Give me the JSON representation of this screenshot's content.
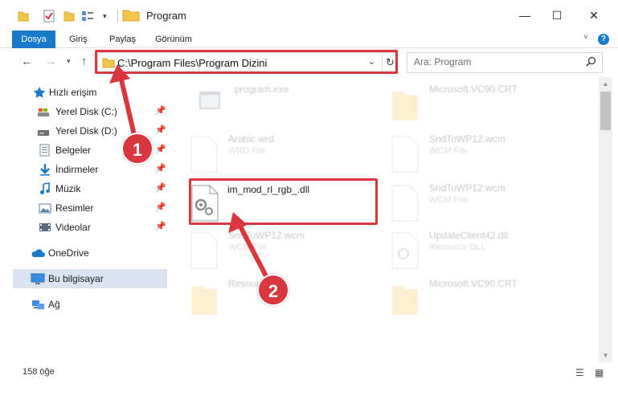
{
  "window": {
    "title": "Program",
    "minimize_glyph": "—",
    "maximize_glyph": "☐",
    "close_glyph": "✕"
  },
  "ribbon": {
    "tabs": [
      {
        "label": "Dosya",
        "active": true
      },
      {
        "label": "Giriş"
      },
      {
        "label": "Paylaş"
      },
      {
        "label": "Görünüm"
      }
    ],
    "help_glyph": "?"
  },
  "address": {
    "path": "C:\\Program Files\\Program Dizini"
  },
  "search": {
    "placeholder": "Ara: Program"
  },
  "sidebar": {
    "quick_access": "Hızlı erişim",
    "items": [
      {
        "label": "Yerel Disk (C:)",
        "icon": "drive-icon",
        "pinned": true
      },
      {
        "label": "Yerel Disk (D:)",
        "icon": "drive-icon",
        "pinned": true
      },
      {
        "label": "Belgeler",
        "icon": "documents-icon",
        "pinned": true
      },
      {
        "label": "İndirmeler",
        "icon": "downloads-icon",
        "pinned": true
      },
      {
        "label": "Müzik",
        "icon": "music-icon",
        "pinned": true
      },
      {
        "label": "Resimler",
        "icon": "pictures-icon",
        "pinned": true
      },
      {
        "label": "Videolar",
        "icon": "videos-icon",
        "pinned": true
      }
    ],
    "onedrive": "OneDrive",
    "this_pc": "Bu bilgisayar",
    "network": "Ağ"
  },
  "files": [
    {
      "name": "program.exe",
      "type": "",
      "icon": "exe-icon"
    },
    {
      "name": "Microsoft.VC90.CRT",
      "type": "",
      "icon": "folder-icon"
    },
    {
      "name": "Arabic.wrd",
      "type": "WRD File",
      "icon": "file-icon"
    },
    {
      "name": "SndToWP12.wcm",
      "type": "WCM File",
      "icon": "file-icon"
    },
    {
      "name": "im_mod_rl_rgb_.dll",
      "type": "",
      "icon": "dll-icon"
    },
    {
      "name": "SndToWP12.wcm",
      "type": "WCM File",
      "icon": "file-icon"
    },
    {
      "name": "SndToWP12.wcm",
      "type": "WCM File",
      "icon": "file-icon"
    },
    {
      "name": "UpdateClient42.dll",
      "type": "Resource DLL",
      "icon": "dll-icon"
    },
    {
      "name": "Resources",
      "type": "",
      "icon": "folder-icon"
    },
    {
      "name": "Microsoft.VC90.CRT",
      "type": "",
      "icon": "folder-icon"
    }
  ],
  "status": {
    "count": "158 öğe"
  },
  "callouts": {
    "step1": "1",
    "step2": "2"
  },
  "colors": {
    "accent": "#1979ca",
    "highlight": "#d9363e",
    "selected_bg": "#d9e4f0"
  }
}
